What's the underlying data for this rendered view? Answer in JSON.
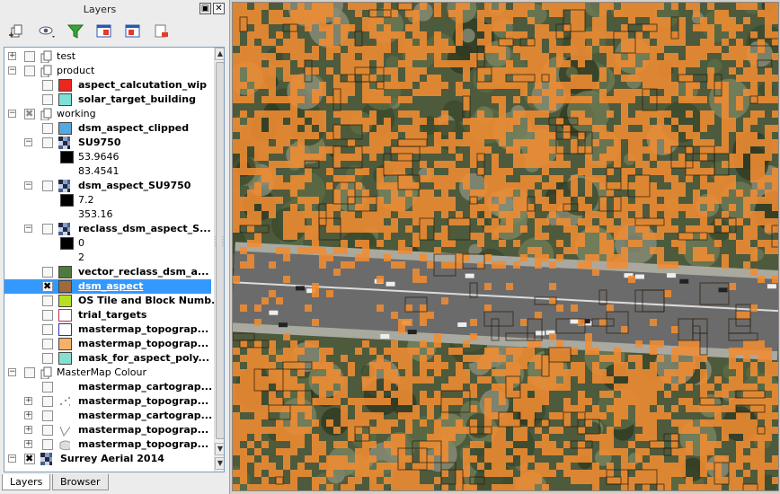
{
  "panel": {
    "title": "Layers",
    "float_button": "▣",
    "close_button": "✕"
  },
  "toolbar": {
    "buttons": [
      {
        "name": "add-group-button",
        "icon": "add-group-icon"
      },
      {
        "name": "manage-visibility-button",
        "icon": "eye-icon"
      },
      {
        "name": "filter-legend-button",
        "icon": "filter-icon"
      },
      {
        "name": "expand-all-button",
        "icon": "expand-all-icon"
      },
      {
        "name": "collapse-all-button",
        "icon": "collapse-all-icon"
      },
      {
        "name": "remove-layer-button",
        "icon": "remove-layer-icon"
      }
    ]
  },
  "tree": {
    "rows": [
      {
        "type": "group",
        "label": "test",
        "level": 0,
        "expander": "+",
        "check": "none",
        "bold": false
      },
      {
        "type": "group",
        "label": "product",
        "level": 0,
        "expander": "-",
        "check": "none",
        "bold": false
      },
      {
        "type": "layer",
        "label": "aspect_calcutation_wip",
        "level": 1,
        "check": "none",
        "swatch": "#e8281e",
        "bold": true
      },
      {
        "type": "layer",
        "label": "solar_target_building",
        "level": 1,
        "check": "none",
        "swatch": "#7fe0d8",
        "bold": true
      },
      {
        "type": "group",
        "label": "working",
        "level": 0,
        "expander": "-",
        "check": "partial",
        "bold": false
      },
      {
        "type": "layer",
        "label": "dsm_aspect_clipped",
        "level": 1,
        "check": "none",
        "swatch": "#55a8e0",
        "bold": true
      },
      {
        "type": "raster",
        "label": "SU9750",
        "level": 1,
        "expander": "-",
        "check": "none",
        "bold": true
      },
      {
        "type": "legend",
        "label": "53.9646",
        "level": 2,
        "swatch": "#000000"
      },
      {
        "type": "legend",
        "label": "83.4541",
        "level": 2,
        "swatch": ""
      },
      {
        "type": "raster",
        "label": "dsm_aspect_SU9750",
        "level": 1,
        "expander": "-",
        "check": "none",
        "bold": true
      },
      {
        "type": "legend",
        "label": "7.2",
        "level": 2,
        "swatch": "#000000"
      },
      {
        "type": "legend",
        "label": "353.16",
        "level": 2,
        "swatch": ""
      },
      {
        "type": "raster",
        "label": "reclass_dsm_aspect_S...",
        "level": 1,
        "expander": "-",
        "check": "none",
        "bold": true
      },
      {
        "type": "legend",
        "label": "0",
        "level": 2,
        "swatch": "#000000"
      },
      {
        "type": "legend",
        "label": "2",
        "level": 2,
        "swatch": ""
      },
      {
        "type": "layer",
        "label": "vector_reclass_dsm_a...",
        "level": 1,
        "check": "none",
        "swatch": "#4f7a3e",
        "bold": true
      },
      {
        "type": "layer",
        "label": "dsm_aspect",
        "level": 1,
        "check": "checked",
        "swatch": "#a06a3a",
        "bold": true,
        "selected": true
      },
      {
        "type": "layer",
        "label": "OS Tile and Block Numb...",
        "level": 1,
        "check": "none",
        "swatch": "#b8e020",
        "bold": true
      },
      {
        "type": "layer",
        "label": "trial_targets",
        "level": 1,
        "check": "none",
        "swatch": "#ffffff",
        "swatch_border": "#c0304a",
        "bold": true
      },
      {
        "type": "layer",
        "label": "mastermap_topograp...",
        "level": 1,
        "check": "none",
        "swatch": "#ffffff",
        "swatch_border": "#3030a0",
        "bold": true
      },
      {
        "type": "layer",
        "label": "mastermap_topograp...",
        "level": 1,
        "check": "none",
        "swatch": "#f7b06a",
        "bold": true
      },
      {
        "type": "layer",
        "label": "mask_for_aspect_poly...",
        "level": 1,
        "check": "none",
        "swatch": "#86e0d0",
        "bold": true
      },
      {
        "type": "group",
        "label": "MasterMap Colour",
        "level": 0,
        "expander": "-",
        "check": "none",
        "bold": false
      },
      {
        "type": "layer",
        "label": "mastermap_cartograp...",
        "level": 1,
        "check": "none",
        "swatch": "",
        "bold": true
      },
      {
        "type": "layer",
        "label": "mastermap_topograp...",
        "level": 1,
        "expander": "+",
        "check": "none",
        "swatch": "points",
        "bold": true
      },
      {
        "type": "layer",
        "label": "mastermap_cartograp...",
        "level": 1,
        "expander": "+",
        "check": "none",
        "swatch": "",
        "bold": true
      },
      {
        "type": "layer",
        "label": "mastermap_topograp...",
        "level": 1,
        "expander": "+",
        "check": "none",
        "swatch": "line",
        "bold": true
      },
      {
        "type": "layer",
        "label": "mastermap_topograp...",
        "level": 1,
        "expander": "+",
        "check": "none",
        "swatch": "poly",
        "bold": true
      },
      {
        "type": "raster",
        "label": "Surrey Aerial 2014",
        "level": 0,
        "expander": "-",
        "check": "checked",
        "bold": true
      }
    ]
  },
  "tabs": [
    "Layers",
    "Browser"
  ],
  "colors": {
    "aspect_fill": "#f08c32",
    "aspect_stroke": "#2a1a08",
    "selection": "#3399ff"
  }
}
